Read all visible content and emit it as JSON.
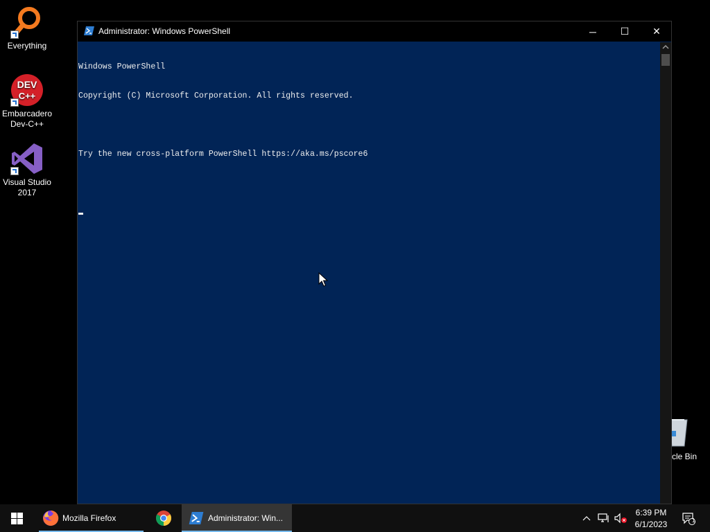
{
  "desktop": {
    "icons": [
      {
        "label": "Everything",
        "icon": "everything-icon"
      },
      {
        "label": "Embarcadero Dev-C++",
        "icon": "devcpp-icon",
        "badge": "DEV C++"
      },
      {
        "label": "Visual Studio 2017",
        "icon": "visual-studio-icon"
      }
    ],
    "recycle_bin": {
      "label": "cle Bin",
      "icon": "recycle-bin-icon"
    }
  },
  "window": {
    "title": "Administrator: Windows PowerShell",
    "controls": {
      "minimize": "─",
      "maximize": "☐",
      "close": "✕"
    },
    "console_lines": [
      "Windows PowerShell",
      "Copyright (C) Microsoft Corporation. All rights reserved.",
      "",
      "Try the new cross-platform PowerShell https://aka.ms/pscore6"
    ],
    "background": "#012456"
  },
  "taskbar": {
    "items": [
      {
        "label": "Mozilla Firefox",
        "icon": "firefox-icon"
      },
      {
        "label": "",
        "icon": "chrome-icon"
      },
      {
        "label": "Administrator: Win...",
        "icon": "powershell-icon"
      }
    ],
    "clock": {
      "time": "6:39 PM",
      "date": "6/1/2023"
    },
    "notifications_count": "1"
  }
}
